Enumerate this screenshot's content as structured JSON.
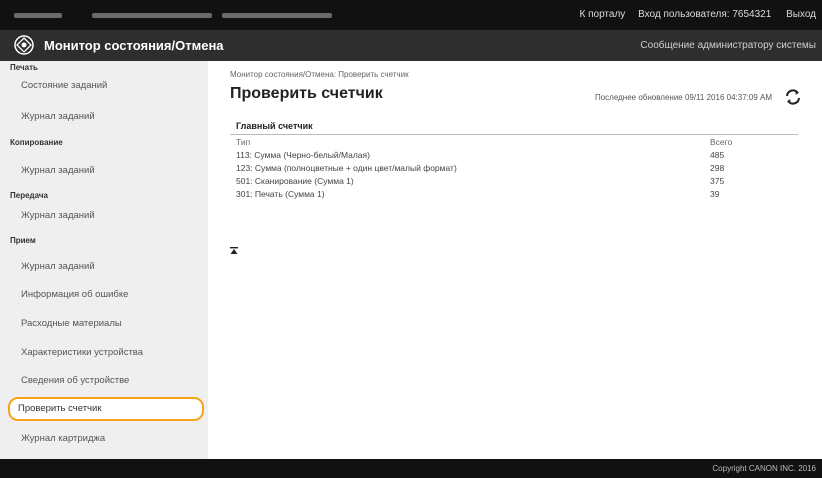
{
  "top_bar": {
    "portal_link": "К порталу",
    "login_user": "Вход пользователя:  7654321",
    "logout": "Выход"
  },
  "title_bar": {
    "logo_icon": "canon-remote-ui-logo-icon",
    "app_title": "Монитор состояния/Отмена",
    "admin_message_link": "Сообщение администратору системы"
  },
  "sidebar": {
    "print_section": "Печать",
    "print_jobs": "Состояние заданий",
    "print_log": "Журнал заданий",
    "copy_section": "Копирование",
    "copy_log": "Журнал заданий",
    "send_section": "Передача",
    "send_log": "Журнал заданий",
    "receive_section": "Прием",
    "receive_log": "Журнал заданий",
    "error_info": "Информация об ошибке",
    "consumables": "Расходные материалы",
    "device_features": "Характеристики устройства",
    "device_info": "Сведения об устройстве",
    "check_counter": "Проверить счетчик",
    "cartridge_log": "Журнал картриджа",
    "highlight_color": "#f6a51b"
  },
  "main": {
    "breadcrumb": "Монитор состояния/Отмена: Проверить счетчик",
    "page_title": "Проверить счетчик",
    "last_update": "Последнее обновление 09/11 2016 04:37:09 AM",
    "refresh_icon": "refresh-icon",
    "counter": {
      "heading": "Главный счетчик",
      "col_type": "Тип",
      "col_total": "Всего",
      "rows": [
        {
          "type": "113: Сумма (Черно-белый/Малая)",
          "total": "485"
        },
        {
          "type": "123: Сумма (полноцветные + один цвет/малый формат)",
          "total": "298"
        },
        {
          "type": "501: Сканирование (Сумма 1)",
          "total": "375"
        },
        {
          "type": "301: Печать (Сумма 1)",
          "total": "39"
        }
      ]
    },
    "collapse_icon": "collapse-up-icon"
  },
  "footer": {
    "copyright": "Copyright CANON INC. 2016"
  }
}
